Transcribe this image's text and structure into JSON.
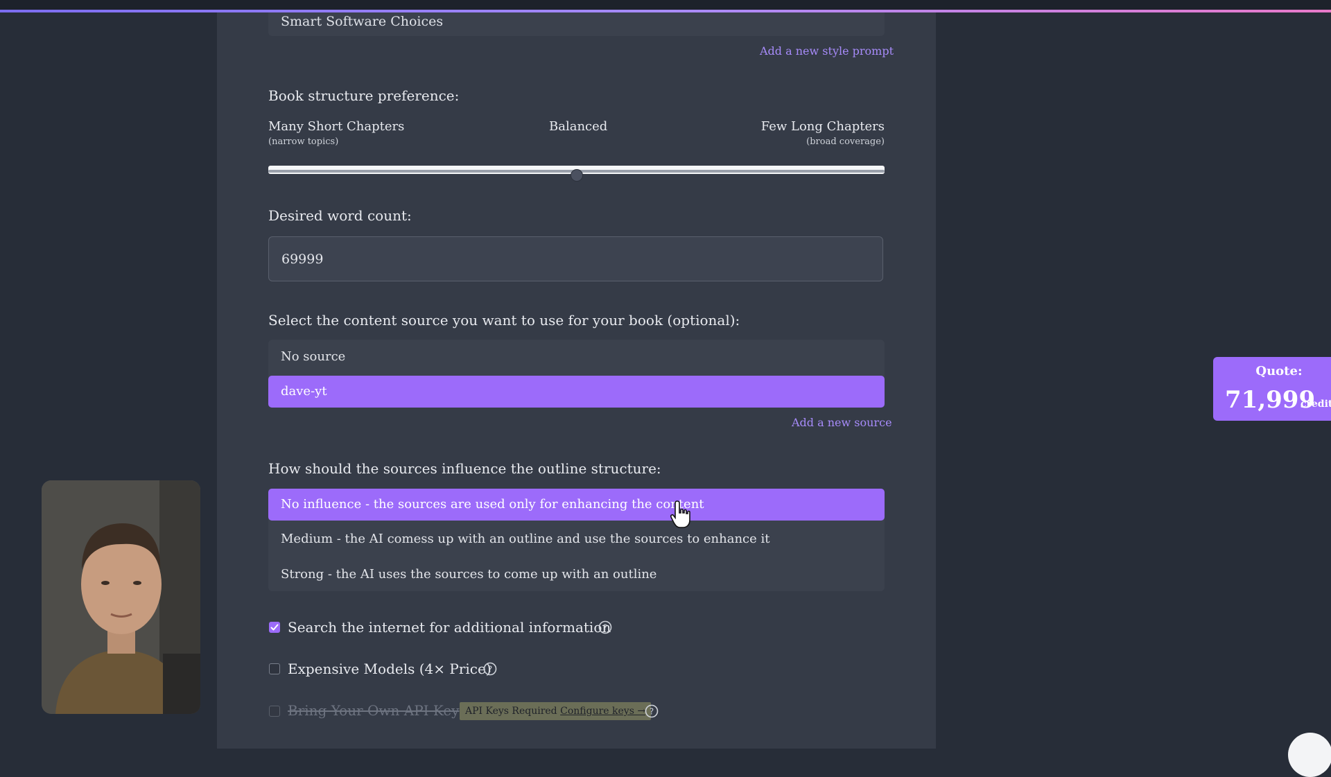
{
  "style_prompt": {
    "selected_value": "Smart Software Choices",
    "add_link": "Add a new style prompt"
  },
  "structure": {
    "label": "Book structure preference:",
    "left_title": "Many Short Chapters",
    "left_sub": "(narrow topics)",
    "mid_title": "Balanced",
    "right_title": "Few Long Chapters",
    "right_sub": "(broad coverage)",
    "slider_value": 0.5
  },
  "word_count": {
    "label": "Desired word count:",
    "value": "69999"
  },
  "source": {
    "label": "Select the content source you want to use for your book (optional):",
    "options": [
      "No source",
      "dave-yt"
    ],
    "selected_index": 1,
    "add_link": "Add a new source"
  },
  "influence": {
    "label": "How should the sources influence the outline structure:",
    "options": [
      "No influence - the sources are used only for enhancing the content",
      "Medium - the AI comess up with an outline and use the sources to enhance it",
      "Strong - the AI uses the sources to come up with an outline"
    ],
    "selected_index": 0
  },
  "checkboxes": {
    "search": {
      "label": "Search the internet for additional information",
      "checked": true
    },
    "expensive": {
      "label": "Expensive Models (4× Price)",
      "checked": false
    },
    "byok": {
      "label": "Bring Your Own API Key",
      "checked": false,
      "disabled": true,
      "badge_text": "API Keys Required",
      "badge_link": "Configure keys →"
    }
  },
  "quote": {
    "title": "Quote:",
    "value": "71,999",
    "unit": "credits"
  },
  "colors": {
    "accent": "#9c6bfa",
    "background": "#272d38",
    "panel": "#353b47"
  }
}
